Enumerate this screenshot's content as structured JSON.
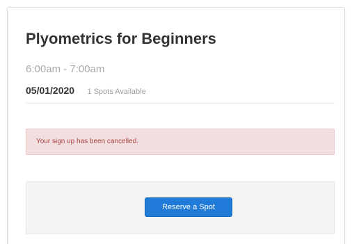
{
  "event": {
    "title": "Plyometrics for Beginners",
    "time": "6:00am - 7:00am",
    "date": "05/01/2020",
    "spots": "1 Spots Available"
  },
  "alert": {
    "message": "Your sign up has been cancelled."
  },
  "actions": {
    "reserve_label": "Reserve a Spot"
  },
  "colors": {
    "alert_background": "#f2dede",
    "alert_text": "#a94442",
    "button_primary": "#1f7ad8"
  }
}
